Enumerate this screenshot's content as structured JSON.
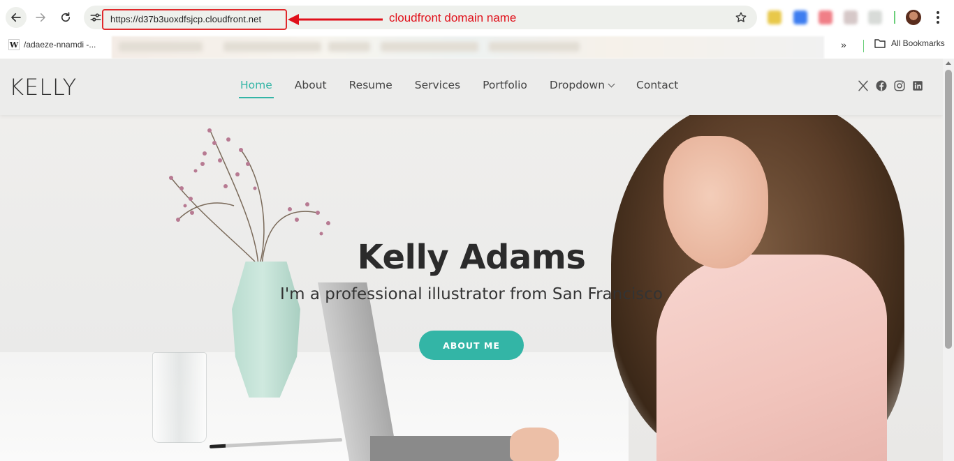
{
  "browser": {
    "url": "https://d37b3uoxdfsjcp.cloudfront.net",
    "annotation": "cloudfront domain name",
    "annotation_color": "#e0101a",
    "bookmarks": {
      "first_item": "/adaeze-nnamdi -...",
      "first_item_icon": "W",
      "overflow": "»",
      "all_bookmarks": "All Bookmarks"
    }
  },
  "site": {
    "logo": "KELLY",
    "accent_color": "#33b5a6",
    "nav": [
      {
        "label": "Home",
        "active": true
      },
      {
        "label": "About",
        "active": false
      },
      {
        "label": "Resume",
        "active": false
      },
      {
        "label": "Services",
        "active": false
      },
      {
        "label": "Portfolio",
        "active": false
      },
      {
        "label": "Dropdown",
        "active": false
      },
      {
        "label": "Contact",
        "active": false
      }
    ],
    "social_icons": [
      "x-icon",
      "facebook-icon",
      "instagram-icon",
      "linkedin-icon"
    ]
  },
  "hero": {
    "title": "Kelly Adams",
    "subtitle": "I'm a professional illustrator from San Francisco",
    "button": "ABOUT ME"
  }
}
